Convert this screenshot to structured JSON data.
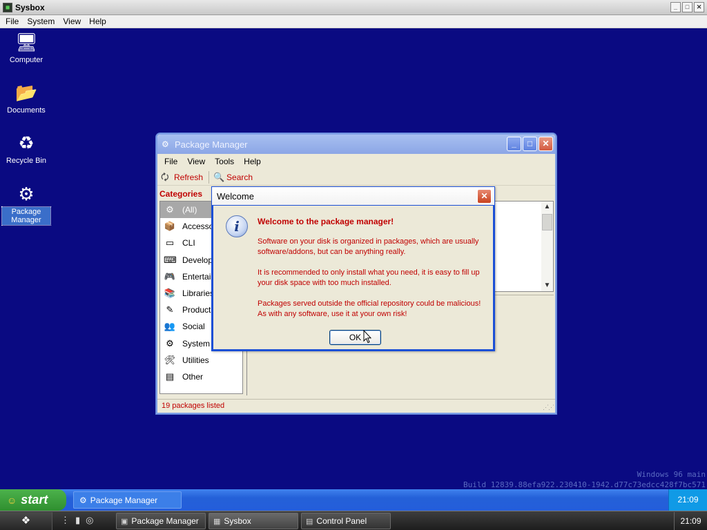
{
  "host": {
    "title": "Sysbox",
    "window_controls": [
      "_",
      "□",
      "✕"
    ],
    "menu": [
      "File",
      "System",
      "View",
      "Help"
    ]
  },
  "desktop": {
    "icons": [
      {
        "label": "Computer",
        "icon": "computer-icon"
      },
      {
        "label": "Documents",
        "icon": "documents-folder-icon"
      },
      {
        "label": "Recycle Bin",
        "icon": "recycle-bin-icon"
      },
      {
        "label": "Package Manager",
        "icon": "package-manager-icon",
        "selected": true
      }
    ],
    "watermark": {
      "line1": "Windows 96 main",
      "line2": "Build 12839.88efa922.230410-1942.d77c73edcc428f7bc571"
    },
    "background_color": "#0a0a82"
  },
  "package_manager": {
    "title": "Package Manager",
    "menu": [
      "File",
      "View",
      "Tools",
      "Help"
    ],
    "toolbar": {
      "refresh": "Refresh",
      "search": "Search"
    },
    "categories_heading": "Categories",
    "categories": [
      {
        "label": "(All)",
        "icon": "all-icon",
        "selected": true
      },
      {
        "label": "Accessor",
        "icon": "accessories-icon"
      },
      {
        "label": "CLI",
        "icon": "cli-icon"
      },
      {
        "label": "Developm",
        "icon": "development-icon"
      },
      {
        "label": "Entertainn",
        "icon": "entertainment-icon"
      },
      {
        "label": "Libraries",
        "icon": "libraries-icon"
      },
      {
        "label": "Productiv",
        "icon": "productivity-icon"
      },
      {
        "label": "Social",
        "icon": "social-icon"
      },
      {
        "label": "System",
        "icon": "system-icon"
      },
      {
        "label": "Utilities",
        "icon": "utilities-icon"
      },
      {
        "label": "Other",
        "icon": "other-icon"
      }
    ],
    "status": "19 packages listed"
  },
  "dialog": {
    "title": "Welcome",
    "heading": "Welcome to the package manager!",
    "paragraphs": [
      "Software on your disk is organized in packages, which are usually software/addons, but can be anything really.",
      "It is recommended to only install what you need, it is easy to fill up your disk space with too much installed.",
      "Packages served outside the official repository could be malicious! As with any software, use it at your own risk!"
    ],
    "ok_label": "OK",
    "text_color": "#c00000"
  },
  "guest_taskbar": {
    "start_label": "start",
    "tasks": [
      {
        "label": "Package Manager"
      }
    ],
    "clock": "21:09"
  },
  "host_taskbar": {
    "tasks": [
      {
        "label": "Package Manager"
      },
      {
        "label": "Sysbox"
      },
      {
        "label": "Control Panel"
      }
    ],
    "clock": "21:09"
  }
}
